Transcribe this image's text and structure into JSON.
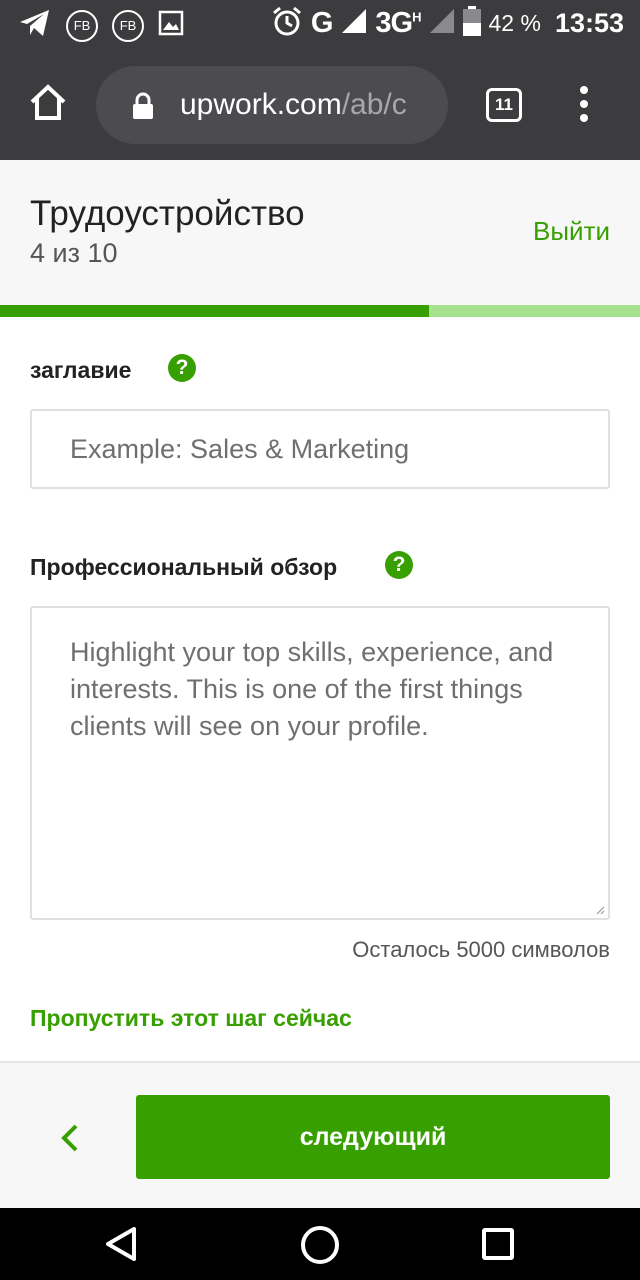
{
  "status_bar": {
    "notifications": [
      "telegram-icon",
      "fb-icon",
      "fb-icon",
      "image-icon"
    ],
    "fb_label": "FB",
    "network_g": "G",
    "network_3g": "3G",
    "network_h": "H",
    "battery": "42 %",
    "time": "13:53"
  },
  "browser": {
    "url_host": "upwork.com",
    "url_path": "/ab/c",
    "tab_count": "11"
  },
  "header": {
    "title": "Трудоустройство",
    "step": "4 из 10",
    "exit_label": "Выйти"
  },
  "progress": {
    "fraction": 0.67
  },
  "form": {
    "title_label": "заглавие",
    "title_placeholder": "Example: Sales & Marketing",
    "overview_label": "Профессиональный обзор",
    "overview_placeholder": "Highlight your top skills, experience, and interests. This is one of the first things clients will see on your profile.",
    "chars_left": "Осталось 5000 символов",
    "skip_label": "Пропустить этот шаг сейчас",
    "help_glyph": "?"
  },
  "footer": {
    "next_label": "следующий"
  },
  "colors": {
    "accent": "#37a000",
    "progress_track": "#a6e28e",
    "chrome_bg": "#3c3c3f"
  }
}
